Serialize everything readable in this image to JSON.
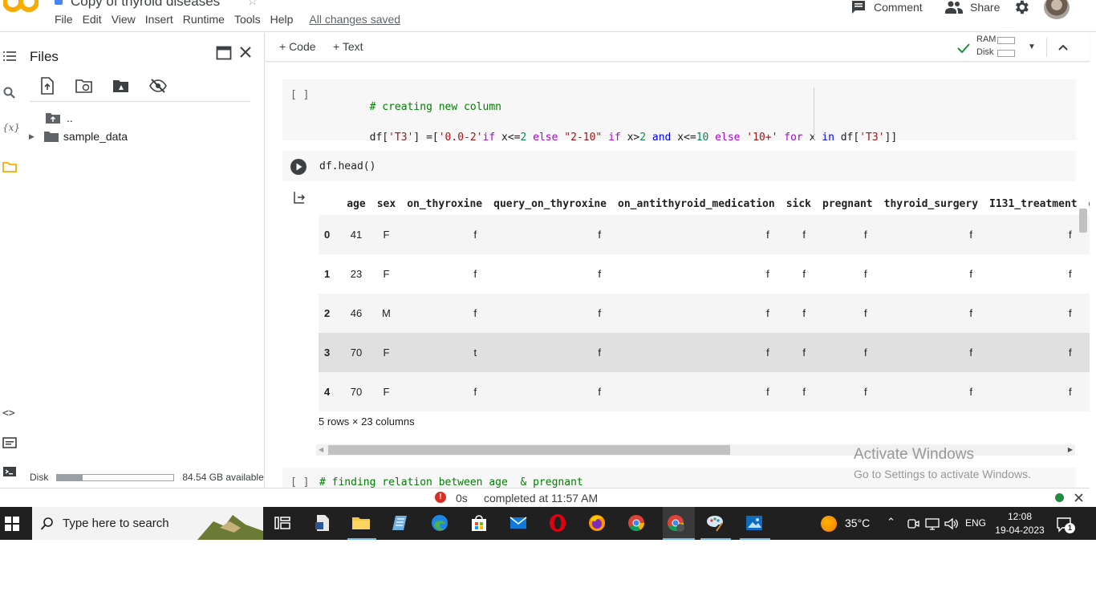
{
  "app": {
    "title": "Copy of thyroid diseases",
    "menu": [
      "File",
      "Edit",
      "View",
      "Insert",
      "Runtime",
      "Tools",
      "Help"
    ],
    "save_status": "All changes saved",
    "comment_label": "Comment",
    "share_label": "Share"
  },
  "files_panel": {
    "title": "Files",
    "tree": [
      {
        "label": ".."
      },
      {
        "label": "sample_data"
      }
    ],
    "disk_label": "Disk",
    "disk_available": "84.54 GB available",
    "disk_used_fraction": 0.22
  },
  "toolbar": {
    "add_code": "+ Code",
    "add_text": "+ Text",
    "ram_label": "RAM",
    "disk_label": "Disk"
  },
  "cells": {
    "cell1": {
      "bracket": "[ ]",
      "line1": "# creating new column",
      "line2_parts": [
        "df[",
        "'T3'",
        "] =[",
        "'0.0-2'",
        "if",
        " x<=",
        "2",
        " ",
        "else",
        " ",
        "\"2-10\"",
        " ",
        "if",
        " x>",
        "2",
        " ",
        "and",
        " x<=",
        "10",
        " ",
        "else",
        " ",
        "'10+'",
        " ",
        "for",
        " x ",
        "in",
        " df[",
        "'T3'",
        "]]"
      ]
    },
    "cell2": {
      "code": "df.head()",
      "columns": [
        "",
        "age",
        "sex",
        "on_thyroxine",
        "query_on_thyroxine",
        "on_antithyroid_medication",
        "sick",
        "pregnant",
        "thyroid_surgery",
        "I131_treatment",
        "q"
      ],
      "rows": [
        [
          "0",
          "41",
          "F",
          "f",
          "f",
          "f",
          "f",
          "f",
          "f",
          "f"
        ],
        [
          "1",
          "23",
          "F",
          "f",
          "f",
          "f",
          "f",
          "f",
          "f",
          "f"
        ],
        [
          "2",
          "46",
          "M",
          "f",
          "f",
          "f",
          "f",
          "f",
          "f",
          "f"
        ],
        [
          "3",
          "70",
          "F",
          "t",
          "f",
          "f",
          "f",
          "f",
          "f",
          "f"
        ],
        [
          "4",
          "70",
          "F",
          "f",
          "f",
          "f",
          "f",
          "f",
          "f",
          "f"
        ]
      ],
      "shape_note": "5 rows × 23 columns",
      "hscroll_fraction": 0.53
    },
    "cell3": {
      "bracket": "[ ]",
      "code": "# finding relation between age  & pregnant"
    }
  },
  "watermark": {
    "title": "Activate Windows",
    "subtitle": "Go to Settings to activate Windows."
  },
  "status_bar": {
    "duration": "0s",
    "completed": "completed at 11:57 AM"
  },
  "taskbar": {
    "search_placeholder": "Type here to search",
    "weather": "35°C",
    "language": "ENG",
    "time": "12:08",
    "date": "19-04-2023",
    "notification_count": "1"
  },
  "colors": {
    "accent": "#f9ab00",
    "comment_green": "#008000",
    "string_red": "#a31515",
    "keyword_purple": "#af00db",
    "number_green": "#098658",
    "status_ok": "#1e8e3e",
    "error_red": "#d93025"
  }
}
